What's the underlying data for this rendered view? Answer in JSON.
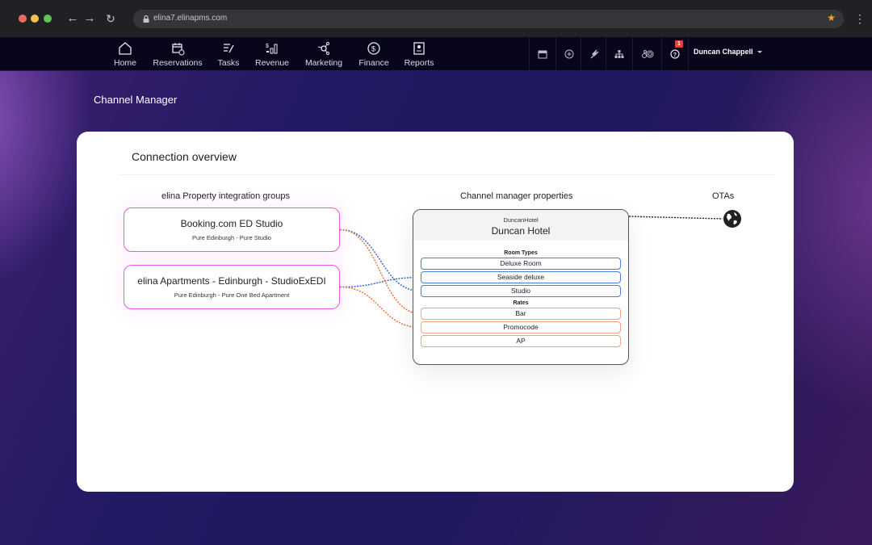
{
  "browser": {
    "url": "elina7.elinapms.com"
  },
  "nav": {
    "items": [
      {
        "label": "Home",
        "icon": "home-icon"
      },
      {
        "label": "Reservations",
        "icon": "calendar-check-icon"
      },
      {
        "label": "Tasks",
        "icon": "tasks-icon"
      },
      {
        "label": "Revenue",
        "icon": "revenue-icon"
      },
      {
        "label": "Marketing",
        "icon": "marketing-icon"
      },
      {
        "label": "Finance",
        "icon": "dollar-circle-icon"
      },
      {
        "label": "Reports",
        "icon": "report-icon"
      }
    ],
    "tools": [
      "calendar-icon",
      "plus-circle-icon",
      "plug-icon",
      "sitemap-icon",
      "settings-icon",
      "help-icon"
    ],
    "help_badge": "1",
    "user_name": "Duncan Chappell"
  },
  "page": {
    "title": "Channel Manager"
  },
  "overview": {
    "title": "Connection overview",
    "col_groups": "elina Property integration groups",
    "col_properties": "Channel manager properties",
    "col_otas": "OTAs",
    "groups": [
      {
        "name": "Booking.com ED Studio",
        "subtitle": "Pure Edinburgh - Pure Studio"
      },
      {
        "name": "elina Apartments - Edinburgh - StudioExEDI",
        "subtitle": "Pure Edinburgh - Pure One Bed Apartment"
      }
    ],
    "property": {
      "code": "DuncanHotel",
      "name": "Duncan Hotel",
      "room_types_label": "Room Types",
      "room_types": [
        "Deluxe Room",
        "Seaside deluxe",
        "Studio"
      ],
      "rates_label": "Rates",
      "rates": [
        "Bar",
        "Promocode",
        "AP"
      ]
    },
    "connections": [
      {
        "group": 0,
        "kind": "room",
        "target": "Studio"
      },
      {
        "group": 0,
        "kind": "rate",
        "target": "Bar"
      },
      {
        "group": 1,
        "kind": "room",
        "target": "Seaside deluxe"
      },
      {
        "group": 1,
        "kind": "rate",
        "target": "Promocode"
      }
    ],
    "colors": {
      "group_border": "#e85ae0",
      "room_link": "#2a5ed8",
      "rate_link": "#f06a3c"
    }
  }
}
